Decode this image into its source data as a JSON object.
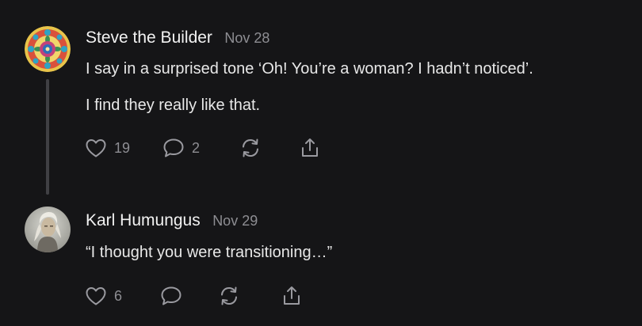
{
  "comments": [
    {
      "author": "Steve the Builder",
      "date": "Nov 28",
      "body": [
        "I say in a surprised tone ‘Oh! You’re a woman? I hadn’t noticed’.",
        "I find they really like that."
      ],
      "likes": "19",
      "replies": "2",
      "avatar_icon": "mandala-avatar"
    },
    {
      "author": "Karl Humungus",
      "date": "Nov 29",
      "body": [
        "“I thought you were transitioning…”"
      ],
      "likes": "6",
      "replies": "",
      "avatar_icon": "photo-avatar"
    }
  ],
  "icons": {
    "like": "heart-icon",
    "reply": "speech-bubble-icon",
    "restack": "restack-icon",
    "share": "share-icon"
  },
  "colors": {
    "background": "#151517",
    "text": "#ECECEC",
    "muted": "#8E8E93",
    "thread_line": "#404044"
  }
}
